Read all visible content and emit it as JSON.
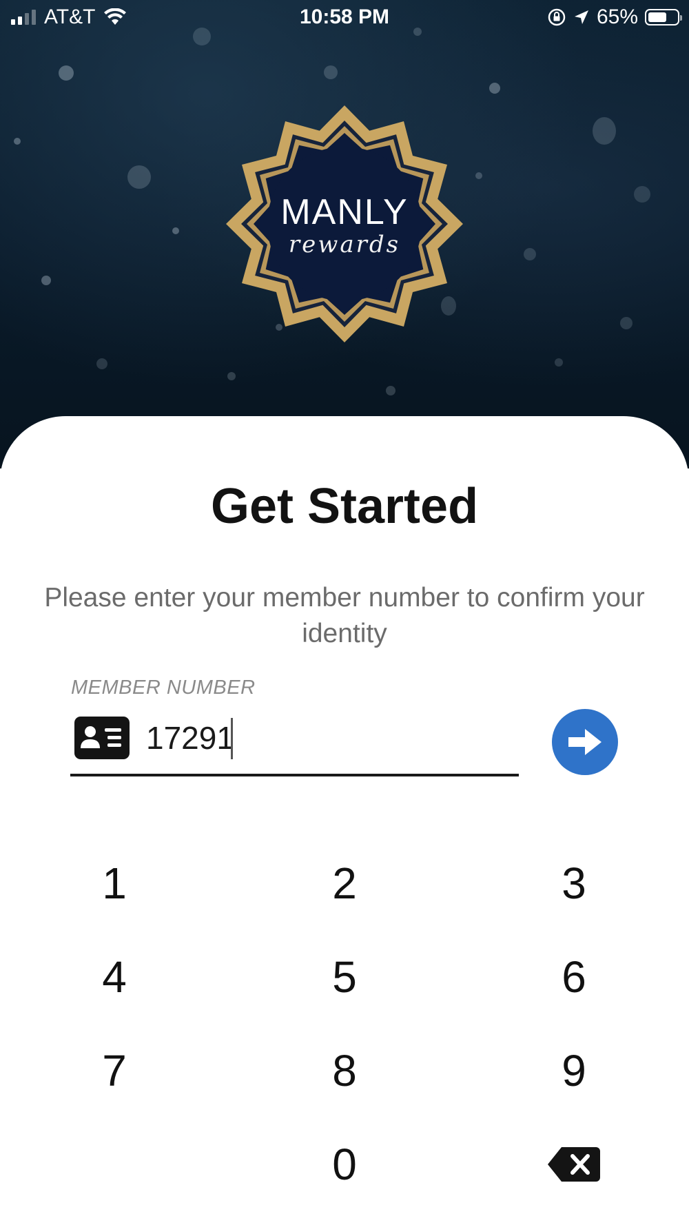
{
  "status_bar": {
    "carrier": "AT&T",
    "time": "10:58 PM",
    "battery_percent": "65%",
    "battery_level": 0.65,
    "icons": [
      "cellular-signal-icon",
      "wifi-icon",
      "orientation-lock-icon",
      "location-arrow-icon",
      "battery-icon"
    ]
  },
  "logo": {
    "brand": "MANLY",
    "tagline": "rewards"
  },
  "main": {
    "title": "Get Started",
    "subtitle": "Please enter your member number to confirm your identity"
  },
  "member_field": {
    "label": "MEMBER NUMBER",
    "value": "17291",
    "icon": "id-card-icon"
  },
  "submit": {
    "icon": "arrow-right-icon",
    "color": "#2f73c9"
  },
  "keypad": {
    "keys": [
      "1",
      "2",
      "3",
      "4",
      "5",
      "6",
      "7",
      "8",
      "9",
      "0"
    ],
    "backspace_icon": "backspace-icon"
  },
  "colors": {
    "hero_background": "#0a1b2b",
    "logo_gold": "#c9a662",
    "logo_navy": "#0c1a3a",
    "accent_blue": "#2f73c9"
  }
}
